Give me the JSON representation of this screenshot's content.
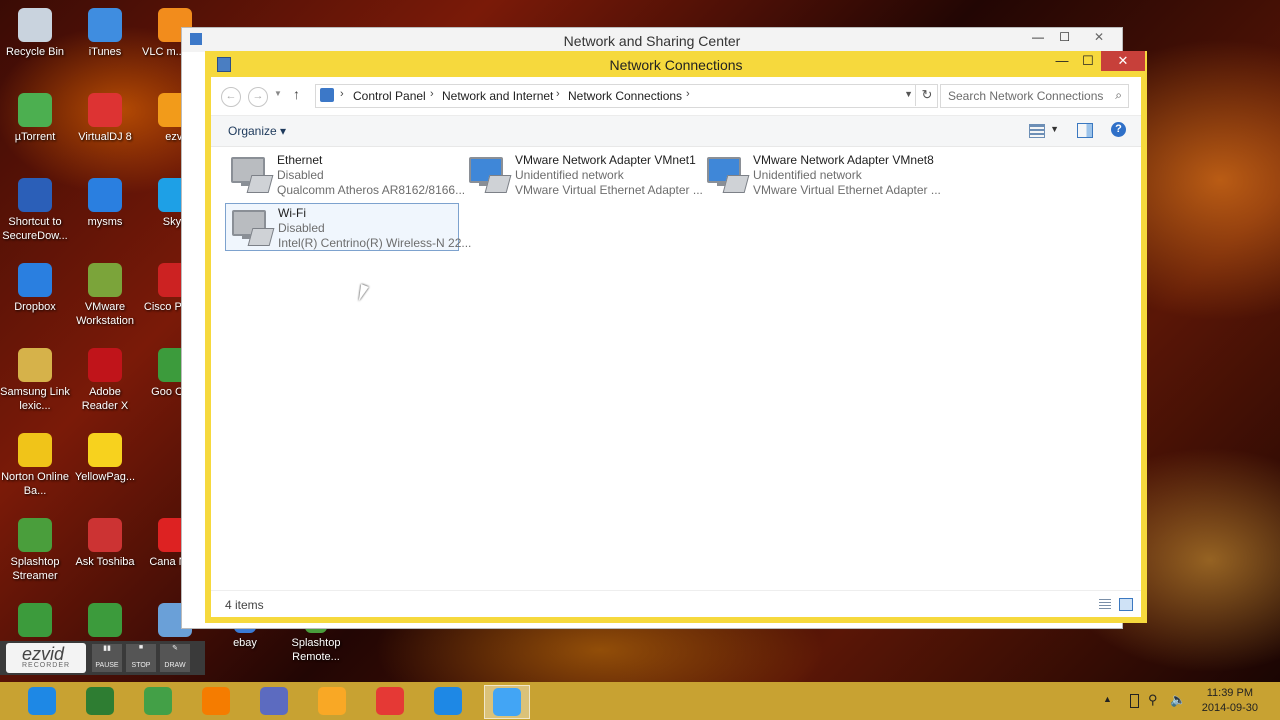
{
  "desktop_icons": [
    {
      "label": "Recycle Bin",
      "icon": "recycle-bin-icon",
      "color": "#c9d3de"
    },
    {
      "label": "iTunes",
      "icon": "itunes-icon",
      "color": "#3f8de0"
    },
    {
      "label": "VLC m... play",
      "icon": "vlc-icon",
      "color": "#f28c1c"
    },
    {
      "label": "µTorrent",
      "icon": "utorrent-icon",
      "color": "#4caf50"
    },
    {
      "label": "VirtualDJ 8",
      "icon": "virtualdj-icon",
      "color": "#d33"
    },
    {
      "label": "ezvi",
      "icon": "ezvid-icon",
      "color": "#f29b1a"
    },
    {
      "label": "Shortcut to SecureDow...",
      "icon": "secure-download-icon",
      "color": "#2b5fb8"
    },
    {
      "label": "mysms",
      "icon": "mysms-icon",
      "color": "#2a7fe0"
    },
    {
      "label": "Skyp",
      "icon": "skype-icon",
      "color": "#1ea0e6"
    },
    {
      "label": "Dropbox",
      "icon": "dropbox-icon",
      "color": "#2a7fe0"
    },
    {
      "label": "VMware Workstation",
      "icon": "vmware-icon",
      "color": "#7ba43a"
    },
    {
      "label": "Cisco P Trac",
      "icon": "cisco-icon",
      "color": "#c22"
    },
    {
      "label": "Samsung Link lexic...",
      "icon": "samsung-link-icon",
      "color": "#d6b24a"
    },
    {
      "label": "Adobe Reader X",
      "icon": "adobe-reader-icon",
      "color": "#c0141a"
    },
    {
      "label": "Goo Chro",
      "icon": "chrome-icon",
      "color": "#3c9b3c"
    },
    {
      "label": "Norton Online Ba...",
      "icon": "norton-icon",
      "color": "#f0c419"
    },
    {
      "label": "YellowPag...",
      "icon": "yellowpages-icon",
      "color": "#f7d21e"
    },
    {
      "label": "Splashtop Streamer",
      "icon": "splashtop-icon",
      "color": "#4a9e3c"
    },
    {
      "label": "Ask Toshiba",
      "icon": "ask-toshiba-icon",
      "color": "#c33"
    },
    {
      "label": "Cana New",
      "icon": "canada-news-icon",
      "color": "#d22"
    },
    {
      "label": "",
      "icon": "chrome-icon",
      "color": "#3c9b3c"
    },
    {
      "label": "",
      "icon": "chrome-icon",
      "color": "#3c9b3c"
    },
    {
      "label": "",
      "icon": "shortcut-icon",
      "color": "#6aa0d8"
    },
    {
      "label": "ebay",
      "icon": "ebay-icon",
      "color": "#3a7bd5"
    },
    {
      "label": "Splashtop Remote...",
      "icon": "splashtop-remote-icon",
      "color": "#4a9e3c"
    }
  ],
  "ezvid": {
    "brand": "ezvid",
    "sub": "RECORDER",
    "buttons": [
      "PAUSE",
      "STOP",
      "DRAW"
    ]
  },
  "back_window": {
    "title": "Network and Sharing Center"
  },
  "window": {
    "title": "Network Connections",
    "caption_buttons": {
      "minimize": "—",
      "maximize": "☐",
      "close": "✕"
    },
    "accent": "#f6d93d",
    "breadcrumb": [
      "Control Panel",
      "Network and Internet",
      "Network Connections"
    ],
    "search_placeholder": "Search Network Connections",
    "organize_label": "Organize ▾",
    "status": "4 items",
    "connections": [
      {
        "name": "Ethernet",
        "status": "Disabled",
        "device": "Qualcomm Atheros AR8162/8166...",
        "icon": "ethernet-adapter-icon",
        "selected": false,
        "enabled": false
      },
      {
        "name": "VMware Network Adapter VMnet1",
        "status": "Unidentified network",
        "device": "VMware Virtual Ethernet Adapter ...",
        "icon": "network-adapter-icon",
        "selected": false,
        "enabled": true
      },
      {
        "name": "VMware Network Adapter VMnet8",
        "status": "Unidentified network",
        "device": "VMware Virtual Ethernet Adapter ...",
        "icon": "network-adapter-icon",
        "selected": false,
        "enabled": true
      },
      {
        "name": "Wi-Fi",
        "status": "Disabled",
        "device": "Intel(R) Centrino(R) Wireless-N 22...",
        "icon": "wifi-adapter-icon",
        "selected": true,
        "enabled": false
      }
    ]
  },
  "taskbar": {
    "color": "#c8a232",
    "apps": [
      {
        "name": "internet-explorer-icon",
        "color": "#1e88e5"
      },
      {
        "name": "word-icon",
        "color": "#2e7d32"
      },
      {
        "name": "evernote-icon",
        "color": "#43a047"
      },
      {
        "name": "speedometer-icon",
        "color": "#f57c00"
      },
      {
        "name": "disk-tool-icon",
        "color": "#5c6bc0"
      },
      {
        "name": "file-explorer-icon",
        "color": "#f9a825"
      },
      {
        "name": "chrome-icon",
        "color": "#e53935"
      },
      {
        "name": "mysms-icon",
        "color": "#1e88e5"
      },
      {
        "name": "control-panel-icon",
        "color": "#42a5f5"
      }
    ],
    "time": "11:39 PM",
    "date": "2014-09-30"
  }
}
